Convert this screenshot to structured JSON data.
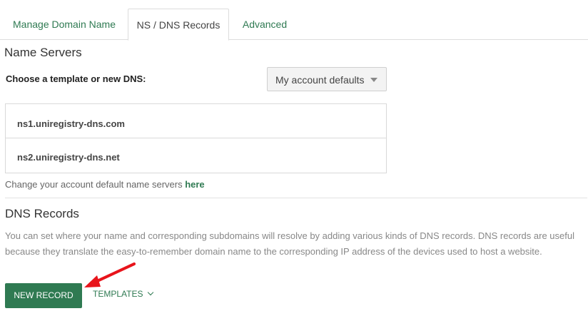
{
  "tabs": [
    {
      "label": "Manage Domain Name"
    },
    {
      "label": "NS / DNS Records"
    },
    {
      "label": "Advanced"
    }
  ],
  "name_servers": {
    "title": "Name Servers",
    "choose_label": "Choose a template or new DNS:",
    "select_value": "My account defaults",
    "servers": [
      "ns1.uniregistry-dns.com",
      "ns2.uniregistry-dns.net"
    ],
    "change_text": "Change your account default name servers ",
    "change_link": "here"
  },
  "dns_records": {
    "title": "DNS Records",
    "description": "You can set where your name and corresponding subdomains will resolve by adding various kinds of DNS records. DNS records are useful because they translate the easy-to-remember domain name to the corresponding IP address of the devices used to host a website.",
    "new_record_label": "NEW RECORD",
    "templates_label": "TEMPLATES"
  },
  "colors": {
    "accent": "#2f7a52",
    "annotation_arrow": "#e8141b"
  },
  "icons": {
    "select_caret": "caret-down-icon",
    "templates_chevron": "chevron-down-icon",
    "annotation": "red-arrow-annotation"
  }
}
